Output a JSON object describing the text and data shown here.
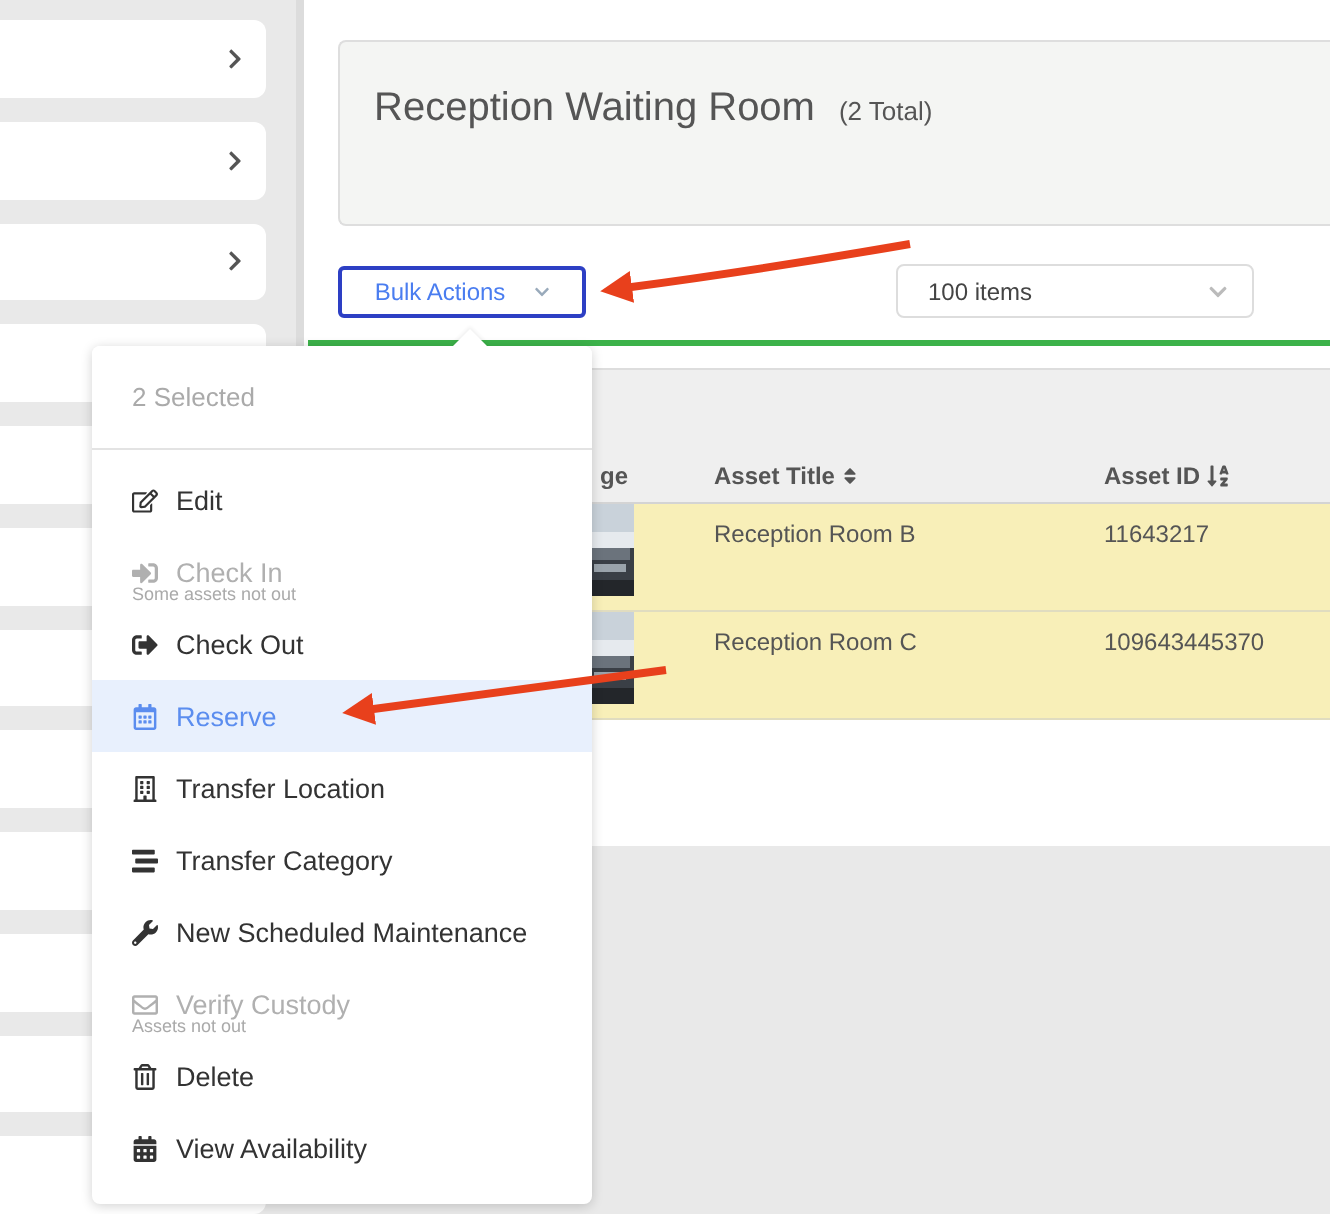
{
  "sidebar": {
    "cards": [
      {
        "has_chevron": true
      },
      {
        "has_chevron": true
      },
      {
        "has_chevron": true
      }
    ]
  },
  "header": {
    "title": "Reception Waiting Room",
    "count": "(2 Total)"
  },
  "toolbar": {
    "bulk_actions": {
      "label": "Bulk Actions",
      "expanded": true
    },
    "page_size": {
      "value": "100 items"
    }
  },
  "table": {
    "columns": [
      {
        "label": "ge",
        "kind": "plain"
      },
      {
        "label": "Asset Title",
        "kind": "sortable"
      },
      {
        "label": "Asset ID",
        "kind": "alpha_sorted"
      }
    ],
    "rows": [
      {
        "title": "Reception Room B",
        "asset_id": "11643217",
        "selected": true
      },
      {
        "title": "Reception Room C",
        "asset_id": "109643445370",
        "selected": true
      }
    ]
  },
  "bulk_menu": {
    "header": "2 Selected",
    "items": [
      {
        "label": "Edit",
        "disabled": false,
        "selected": false
      },
      {
        "label": "Check In",
        "disabled": true,
        "note": "Some assets not out",
        "selected": false
      },
      {
        "label": "Check Out",
        "disabled": false,
        "selected": false
      },
      {
        "label": "Reserve",
        "disabled": false,
        "selected": true
      },
      {
        "label": "Transfer Location",
        "disabled": false,
        "selected": false
      },
      {
        "label": "Transfer Category",
        "disabled": false,
        "selected": false
      },
      {
        "label": "New Scheduled Maintenance",
        "disabled": false,
        "selected": false
      },
      {
        "label": "Verify Custody",
        "disabled": true,
        "note": "Assets not out",
        "selected": false
      },
      {
        "label": "Delete",
        "disabled": false,
        "selected": false
      },
      {
        "label": "View Availability",
        "disabled": false,
        "selected": false
      }
    ]
  }
}
